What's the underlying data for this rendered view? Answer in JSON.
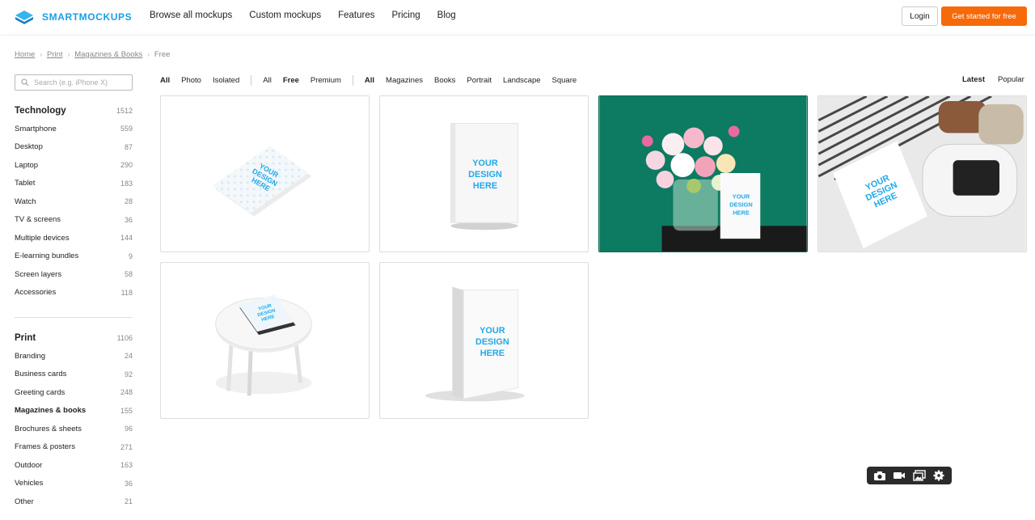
{
  "brand": {
    "name": "SMARTMOCKUPS",
    "accent": "#1a9ee6",
    "cta_color": "#f66a0a"
  },
  "nav": [
    "Browse all mockups",
    "Custom mockups",
    "Features",
    "Pricing",
    "Blog"
  ],
  "header": {
    "login": "Login",
    "cta": "Get started for free"
  },
  "breadcrumb": {
    "items": [
      "Home",
      "Print",
      "Magazines & Books"
    ],
    "current": "Free"
  },
  "search": {
    "placeholder": "Search (e.g. iPhone X)"
  },
  "sidebar": {
    "technology": {
      "title": "Technology",
      "count": "1512",
      "items": [
        {
          "label": "Smartphone",
          "count": "559"
        },
        {
          "label": "Desktop",
          "count": "87"
        },
        {
          "label": "Laptop",
          "count": "290"
        },
        {
          "label": "Tablet",
          "count": "183"
        },
        {
          "label": "Watch",
          "count": "28"
        },
        {
          "label": "TV & screens",
          "count": "36"
        },
        {
          "label": "Multiple devices",
          "count": "144"
        },
        {
          "label": "E-learning bundles",
          "count": "9"
        },
        {
          "label": "Screen layers",
          "count": "58"
        },
        {
          "label": "Accessories",
          "count": "118"
        }
      ]
    },
    "print": {
      "title": "Print",
      "count": "1106",
      "items": [
        {
          "label": "Branding",
          "count": "24"
        },
        {
          "label": "Business cards",
          "count": "92"
        },
        {
          "label": "Greeting cards",
          "count": "248"
        },
        {
          "label": "Magazines & books",
          "count": "155"
        },
        {
          "label": "Brochures & sheets",
          "count": "96"
        },
        {
          "label": "Frames & posters",
          "count": "271"
        },
        {
          "label": "Outdoor",
          "count": "163"
        },
        {
          "label": "Vehicles",
          "count": "36"
        },
        {
          "label": "Other",
          "count": "21"
        }
      ]
    }
  },
  "filters": {
    "type": [
      "All",
      "Photo",
      "Isolated"
    ],
    "price": [
      "All",
      "Free",
      "Premium"
    ],
    "format": [
      "All",
      "Magazines",
      "Books",
      "Portrait",
      "Landscape",
      "Square"
    ]
  },
  "sort": {
    "latest": "Latest",
    "popular": "Popular"
  },
  "mockup_text": {
    "line1": "YOUR",
    "line2": "DESIGN",
    "line3": "HERE"
  },
  "toolbar_icons": [
    "camera-icon",
    "video-icon",
    "gallery-icon",
    "gear-icon"
  ]
}
